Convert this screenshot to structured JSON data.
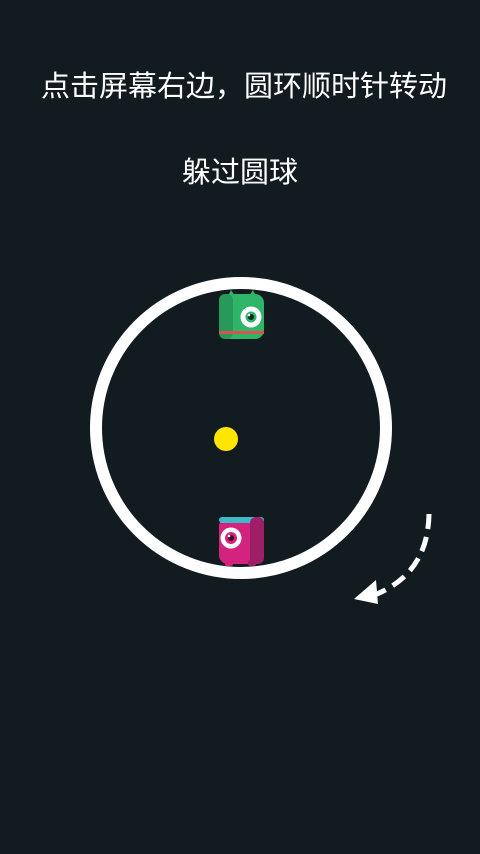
{
  "tutorial": {
    "line1": "点击屏幕右边，圆环顺时针转动",
    "line2": "躲过圆球"
  },
  "colors": {
    "background": "#121b1f",
    "ring": "#ffffff",
    "ball": "#ffe600",
    "green_monster": "#2fb56a",
    "pink_monster": "#d4237e",
    "arrow": "#ffffff"
  },
  "gesture": {
    "direction": "clockwise",
    "icon": "curved-dashed-arrow-icon"
  }
}
